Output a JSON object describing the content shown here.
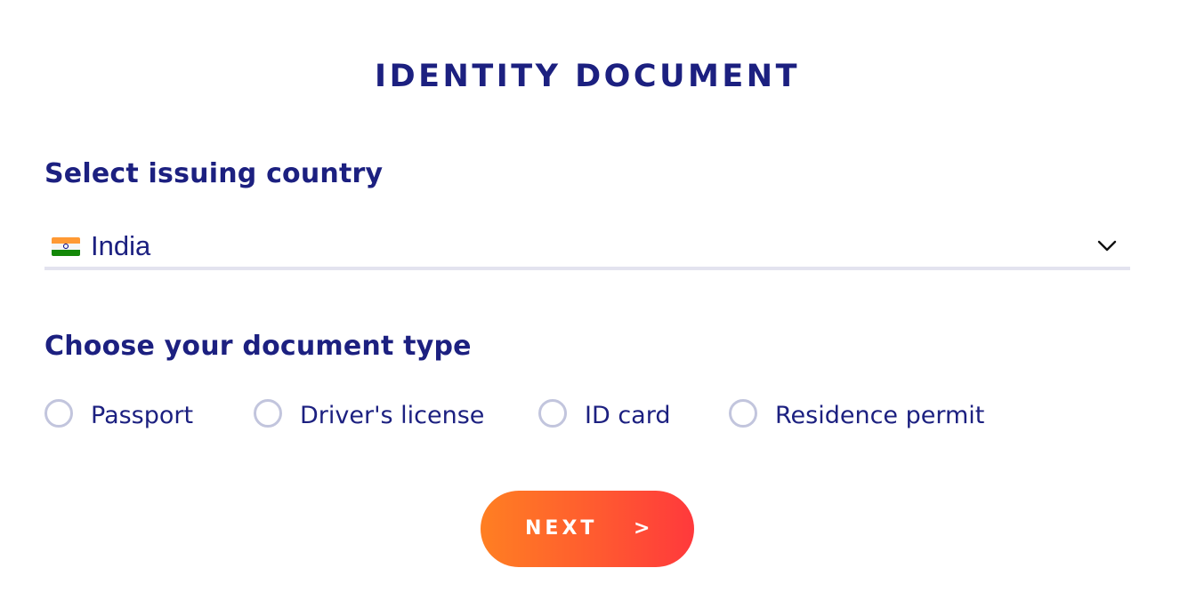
{
  "page": {
    "title": "IDENTITY DOCUMENT"
  },
  "country": {
    "heading": "Select issuing country",
    "selected": "India",
    "flag_icon": "india-flag-icon",
    "dropdown_icon": "chevron-down-icon"
  },
  "document_type": {
    "heading": "Choose your document type",
    "options": [
      {
        "label": "Passport",
        "selected": false
      },
      {
        "label": "Driver's license",
        "selected": false
      },
      {
        "label": "ID card",
        "selected": false
      },
      {
        "label": "Residence permit",
        "selected": false
      }
    ]
  },
  "next_button": {
    "label": "NEXT",
    "arrow": ">"
  },
  "colors": {
    "text_primary": "#1c2080",
    "radio_border": "#c2c5dd",
    "underline": "#e3e3ef",
    "button_gradient_start": "#ff7f22",
    "button_gradient_end": "#ff393c"
  }
}
